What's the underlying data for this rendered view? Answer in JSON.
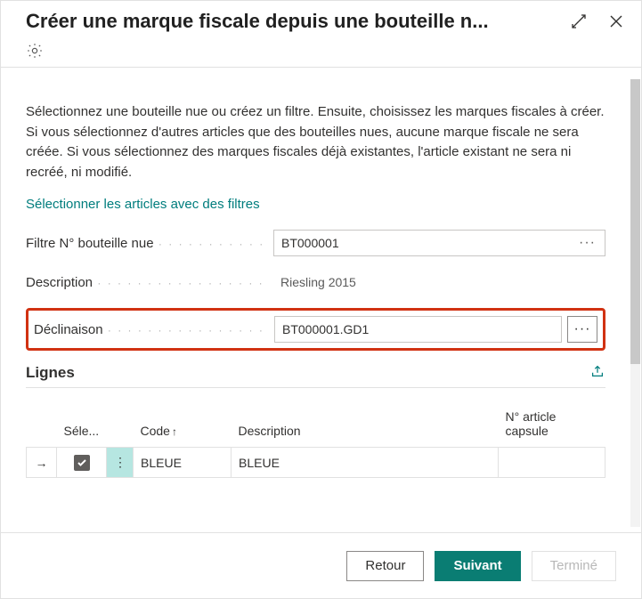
{
  "title": "Créer une marque fiscale depuis une bouteille n...",
  "intro": "Sélectionnez une bouteille nue ou créez un filtre. Ensuite, choisissez les marques fiscales à créer. Si vous sélectionnez d'autres articles que des bouteilles nues, aucune marque fiscale ne sera créée. Si vous sélectionnez des marques fiscales déjà existantes, l'article existant ne sera ni recréé, ni modifié.",
  "link_text": "Sélectionner les articles avec des filtres",
  "fields": {
    "filtre_label": "Filtre N° bouteille nue",
    "filtre_value": "BT000001",
    "description_label": "Description",
    "description_value": "Riesling 2015",
    "declinaison_label": "Déclinaison",
    "declinaison_value": "BT000001.GD1"
  },
  "section_title": "Lignes",
  "table": {
    "headers": {
      "select": "Séle...",
      "code": "Code",
      "description": "Description",
      "capsule": "N° article capsule"
    },
    "rows": [
      {
        "selected": true,
        "code": "BLEUE",
        "description": "BLEUE",
        "capsule": ""
      }
    ]
  },
  "buttons": {
    "back": "Retour",
    "next": "Suivant",
    "finish": "Terminé"
  }
}
